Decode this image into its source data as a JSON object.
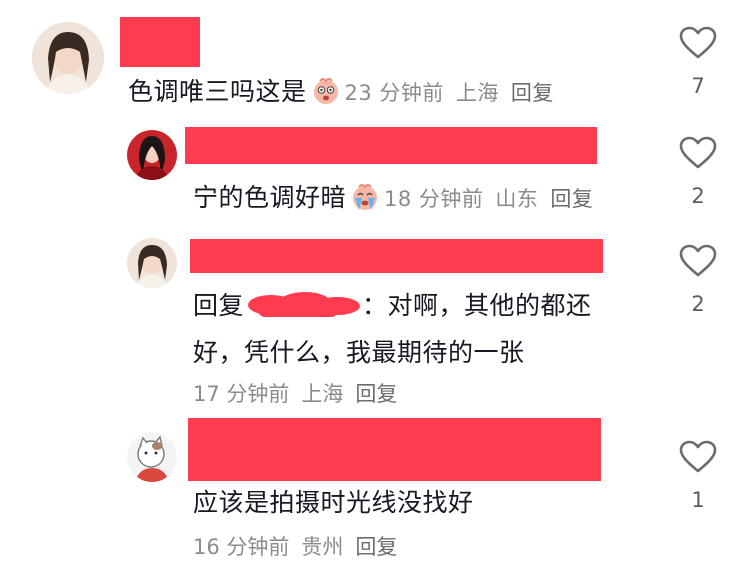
{
  "comments": [
    {
      "text": "色调唯三吗这是",
      "time": "23 分钟前",
      "location": "上海",
      "reply": "回复",
      "likes": "7"
    },
    {
      "text": "宁的色调好暗",
      "time": "18 分钟前",
      "location": "山东",
      "reply": "回复",
      "likes": "2"
    },
    {
      "prefix": "回复",
      "line1_tail": "：对啊，其他的都还",
      "line2": "好，凭什么，我最期待的一张",
      "time": "17 分钟前",
      "location": "上海",
      "reply": "回复",
      "likes": "2"
    },
    {
      "text": "应该是拍摄时光线没找好",
      "time": "16 分钟前",
      "location": "贵州",
      "reply": "回复",
      "likes": "1"
    }
  ],
  "colors": {
    "redaction": "#ff3b4f",
    "meta_text": "#8a8b91",
    "content_text": "#161823"
  },
  "icons": {
    "like": "heart-outline-icon",
    "emoji_1": "shocked-face-emoji",
    "emoji_2": "crying-face-emoji"
  }
}
